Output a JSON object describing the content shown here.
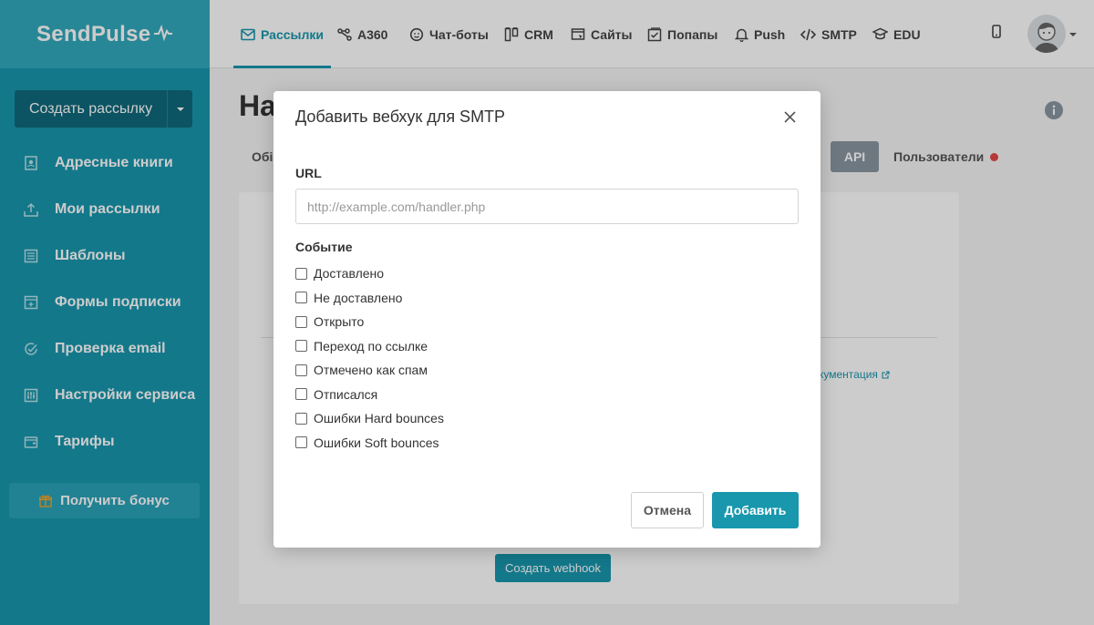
{
  "brand": {
    "name": "SendPulse"
  },
  "sidebar": {
    "create_button": "Создать рассылку",
    "items": [
      {
        "label": "Адресные книги",
        "icon": "address-book-icon"
      },
      {
        "label": "Мои рассылки",
        "icon": "upload-icon"
      },
      {
        "label": "Шаблоны",
        "icon": "templates-icon"
      },
      {
        "label": "Формы подписки",
        "icon": "form-icon"
      },
      {
        "label": "Проверка email",
        "icon": "check-circle-icon"
      },
      {
        "label": "Настройки сервиса",
        "icon": "sliders-icon"
      },
      {
        "label": "Тарифы",
        "icon": "wallet-icon"
      }
    ],
    "bonus_button": "Получить бонус"
  },
  "topnav": {
    "items": [
      {
        "label": "Рассылки",
        "icon": "mail-icon",
        "active": true
      },
      {
        "label": "A360",
        "icon": "nodes-icon"
      },
      {
        "label": "Чат-боты",
        "icon": "chat-icon"
      },
      {
        "label": "CRM",
        "icon": "crm-icon"
      },
      {
        "label": "Сайты",
        "icon": "site-icon"
      },
      {
        "label": "Попапы",
        "icon": "popup-icon"
      },
      {
        "label": "Push",
        "icon": "bell-icon"
      },
      {
        "label": "SMTP",
        "icon": "code-icon"
      },
      {
        "label": "EDU",
        "icon": "graduation-icon"
      }
    ]
  },
  "page": {
    "title": "На",
    "tab_partial": "Обі",
    "tab_api": "API",
    "tab_users": "Пользователи",
    "doc_link": "кументация",
    "create_webhook": "Создать webhook"
  },
  "modal": {
    "title": "Добавить вебхук для SMTP",
    "url_label": "URL",
    "url_placeholder": "http://example.com/handler.php",
    "url_value": "",
    "event_label": "Событие",
    "events": [
      {
        "label": "Доставлено",
        "checked": false
      },
      {
        "label": "Не доставлено",
        "checked": false
      },
      {
        "label": "Открыто",
        "checked": false
      },
      {
        "label": "Переход по ссылке",
        "checked": false
      },
      {
        "label": "Отмечено как спам",
        "checked": false
      },
      {
        "label": "Отписался",
        "checked": false
      },
      {
        "label": "Ошибки Hard bounces",
        "checked": false
      },
      {
        "label": "Ошибки Soft bounces",
        "checked": false
      }
    ],
    "cancel_label": "Отмена",
    "add_label": "Добавить"
  },
  "colors": {
    "accent": "#1897ad",
    "sidebar_bg": "#1897ad",
    "logo_bg": "#32a9bc",
    "api_tab": "#8a97a2",
    "alert_dot": "#e64545"
  }
}
